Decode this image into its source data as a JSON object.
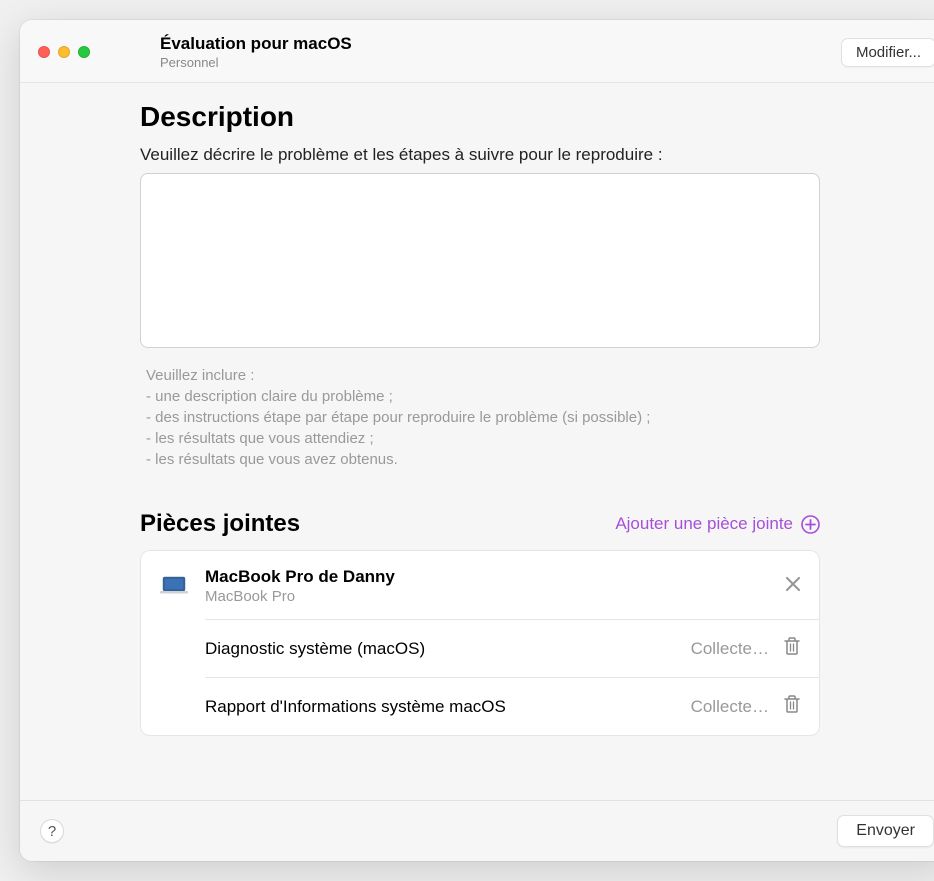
{
  "header": {
    "title": "Évaluation pour macOS",
    "subtitle": "Personnel",
    "modify_label": "Modifier..."
  },
  "description": {
    "heading": "Description",
    "prompt": "Veuillez décrire le problème et les étapes à suivre pour le reproduire :",
    "textarea_value": "",
    "hint_intro": "Veuillez inclure :",
    "hint_1": "- une description claire du problème ;",
    "hint_2": "- des instructions étape par étape pour reproduire le problème (si possible) ;",
    "hint_3": "- les résultats que vous attendiez ;",
    "hint_4": "- les résultats que vous avez obtenus."
  },
  "attachments": {
    "heading": "Pièces jointes",
    "add_label": "Ajouter une pièce jointe",
    "device": {
      "name": "MacBook Pro de Danny",
      "type": "MacBook Pro"
    },
    "items": [
      {
        "label": "Diagnostic système (macOS)",
        "status": "Collecte…"
      },
      {
        "label": "Rapport d'Informations système macOS",
        "status": "Collecte…"
      }
    ]
  },
  "footer": {
    "help": "?",
    "send_label": "Envoyer"
  }
}
